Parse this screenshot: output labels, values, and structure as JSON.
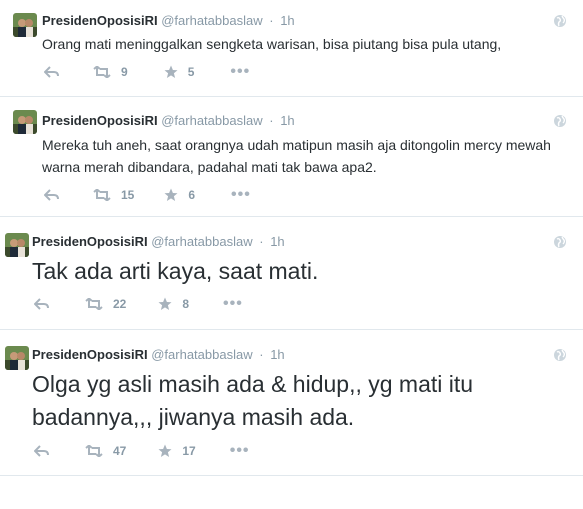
{
  "colors": {
    "name": "#292f33",
    "meta": "#8899a6",
    "divider": "#e1e8ed"
  },
  "tweets": [
    {
      "name": "PresidenOposisiRI",
      "handle": "@farhatabbaslaw",
      "separator": "·",
      "time": "1h",
      "text": "Orang mati meninggalkan sengketa warisan, bisa piutang bisa pula utang,",
      "retweets": "9",
      "favorites": "5"
    },
    {
      "name": "PresidenOposisiRI",
      "handle": "@farhatabbaslaw",
      "separator": "·",
      "time": "1h",
      "text": "Mereka tuh aneh, saat orangnya udah matipun masih aja ditongolin mercy mewah warna merah dibandara, padahal mati tak bawa apa2.",
      "retweets": "15",
      "favorites": "6"
    },
    {
      "name": "PresidenOposisiRI",
      "handle": "@farhatabbaslaw",
      "separator": "·",
      "time": "1h",
      "text": "Tak ada arti kaya, saat mati.",
      "retweets": "22",
      "favorites": "8"
    },
    {
      "name": "PresidenOposisiRI",
      "handle": "@farhatabbaslaw",
      "separator": "·",
      "time": "1h",
      "text": "Olga yg asli masih ada & hidup,, yg mati itu badannya,,, jiwanya masih ada.",
      "retweets": "47",
      "favorites": "17"
    }
  ]
}
